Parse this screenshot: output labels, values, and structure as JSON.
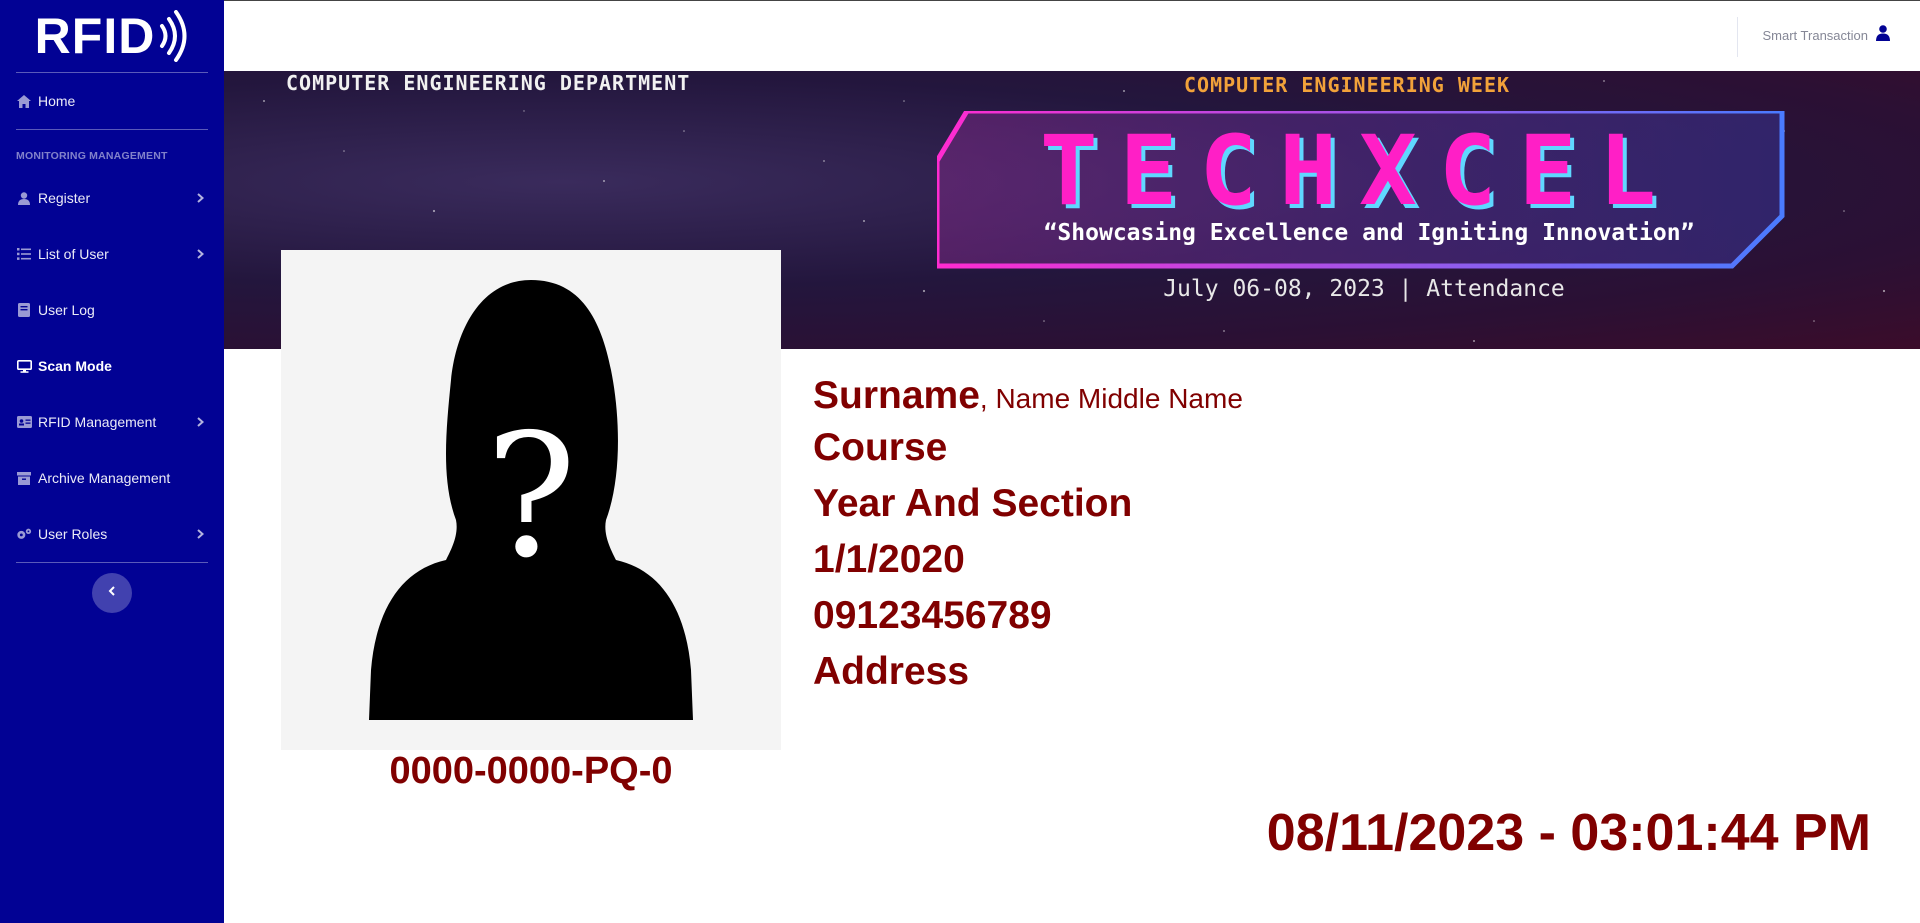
{
  "brand": {
    "logo_text": "RFID"
  },
  "sidebar": {
    "section_heading": "MONITORING MANAGEMENT",
    "items": [
      {
        "label": "Home",
        "icon": "home-icon"
      },
      {
        "label": "Register",
        "icon": "user-icon"
      },
      {
        "label": "List of User",
        "icon": "list-icon"
      },
      {
        "label": "User Log",
        "icon": "book-icon"
      },
      {
        "label": "Scan Mode",
        "icon": "desktop-icon"
      },
      {
        "label": "RFID Management",
        "icon": "id-card-icon"
      },
      {
        "label": "Archive Management",
        "icon": "archive-icon"
      },
      {
        "label": "User Roles",
        "icon": "cogs-icon"
      }
    ],
    "active_item": "Scan Mode"
  },
  "topbar": {
    "user_name": "Smart Transaction"
  },
  "banner": {
    "department": "COMPUTER ENGINEERING DEPARTMENT",
    "event_week": "COMPUTER ENGINEERING WEEK",
    "event_name": "TECHXCEL",
    "tagline": "“Showcasing Excellence and Igniting Innovation”",
    "dates": "July 06-08, 2023 | Attendance"
  },
  "profile": {
    "surname": "Surname",
    "given_names": ", Name Middle Name",
    "course": "Course",
    "year_section": "Year And Section",
    "birthdate": "1/1/2020",
    "phone": "09123456789",
    "address": "Address",
    "student_id": "0000-0000-PQ-0"
  },
  "datetime": "08/11/2023 - 03:01:44 PM",
  "colors": {
    "sidebar": "#020294",
    "text_accent": "#800000",
    "banner_pink": "#ff1fc6",
    "banner_orange": "#f2a23a"
  }
}
